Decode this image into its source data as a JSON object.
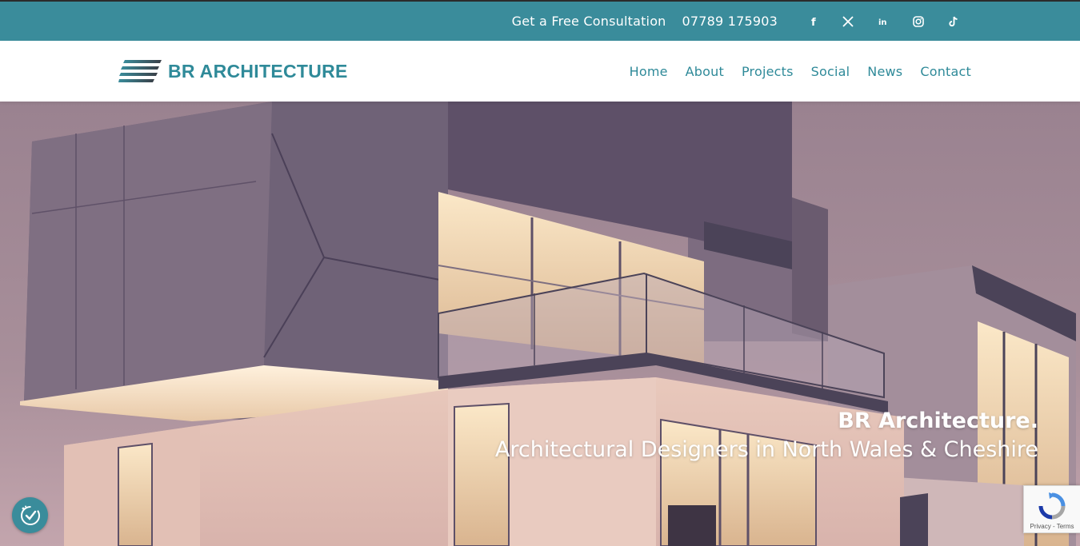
{
  "topbar": {
    "cta": "Get a Free Consultation",
    "phone": "07789 175903",
    "socials": [
      {
        "icon": "facebook-icon",
        "glyph": "f"
      },
      {
        "icon": "x-icon",
        "glyph": "X"
      },
      {
        "icon": "linkedin-icon",
        "glyph": "in"
      },
      {
        "icon": "instagram-icon",
        "glyph": ""
      },
      {
        "icon": "tiktok-icon",
        "glyph": ""
      }
    ]
  },
  "brand": {
    "name": "BR ARCHITECTURE"
  },
  "nav": {
    "home": "Home",
    "about": "About",
    "projects": "Projects",
    "social": "Social",
    "news": "News",
    "contact": "Contact"
  },
  "hero": {
    "title": "BR Architecture.",
    "subtitle": "Architectural Designers in North Wales & Cheshire"
  },
  "recaptcha": {
    "privacy": "Privacy",
    "separator": " - ",
    "terms": "Terms"
  },
  "colors": {
    "accent": "#3a8c9b",
    "brand_text": "#2f8a99",
    "sky": "#9a8290"
  }
}
